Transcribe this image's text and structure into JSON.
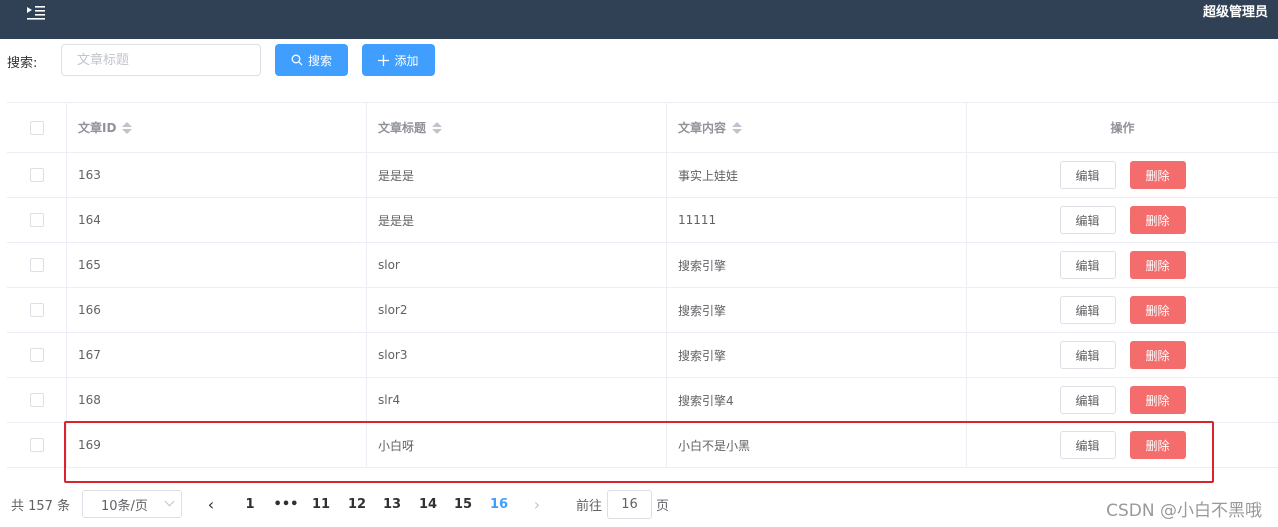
{
  "topbar": {
    "user": "超级管理员",
    "menu_icon": "menu-fold-icon"
  },
  "search": {
    "label": "搜索:",
    "placeholder": "文章标题",
    "search_button": "搜索",
    "add_button": "添加"
  },
  "table": {
    "columns": [
      "文章ID",
      "文章标题",
      "文章内容",
      "操作"
    ],
    "rows": [
      {
        "id": "163",
        "title": "是是是",
        "content": "事实上娃娃"
      },
      {
        "id": "164",
        "title": "是是是",
        "content": "11111"
      },
      {
        "id": "165",
        "title": "slor",
        "content": "搜索引擎"
      },
      {
        "id": "166",
        "title": "slor2",
        "content": "搜索引擎"
      },
      {
        "id": "167",
        "title": "slor3",
        "content": "搜索引擎"
      },
      {
        "id": "168",
        "title": "slr4",
        "content": "搜索引擎4"
      },
      {
        "id": "169",
        "title": "小白呀",
        "content": "小白不是小黑"
      }
    ],
    "edit_label": "编辑",
    "delete_label": "删除"
  },
  "pagination": {
    "total": "共 157 条",
    "page_size": "10条/页",
    "pages": [
      "1",
      "•••",
      "11",
      "12",
      "13",
      "14",
      "15",
      "16"
    ],
    "current": "16",
    "goto_label": "前往",
    "goto_value": "16",
    "page_suffix": "页"
  },
  "watermark": "CSDN @小白不黑哦",
  "colors": {
    "primary": "#409eff",
    "danger": "#f56c6c",
    "topbar": "#304156",
    "highlight": "#d9232d"
  }
}
